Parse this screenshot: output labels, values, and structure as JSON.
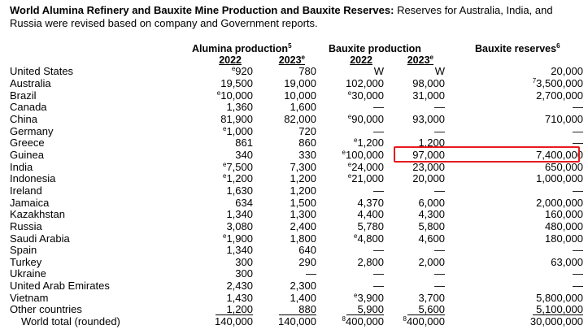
{
  "title": {
    "bold": "World Alumina Refinery and Bauxite Mine Production and Bauxite Reserves",
    "rest": " Reserves for Australia, India, and Russia were revised based on company and Government reports."
  },
  "headers": {
    "alumina": {
      "label": "Alumina production",
      "sup": "5"
    },
    "bauxite": {
      "label": "Bauxite production"
    },
    "reserves": {
      "label": "Bauxite reserves",
      "sup": "6"
    },
    "years": [
      {
        "v": "2022"
      },
      {
        "v": "2023",
        "sup": "e"
      },
      {
        "v": "2022"
      },
      {
        "v": "2023",
        "sup": "e"
      }
    ]
  },
  "highlight_color": "#e8191c",
  "rows": [
    {
      "country": "United States",
      "cells": [
        {
          "sup": "e",
          "v": "920"
        },
        {
          "v": "780"
        },
        {
          "v": "W"
        },
        {
          "v": "W"
        },
        {
          "v": "20,000"
        }
      ]
    },
    {
      "country": "Australia",
      "cells": [
        {
          "v": "19,500"
        },
        {
          "v": "19,000"
        },
        {
          "v": "102,000"
        },
        {
          "v": "98,000"
        },
        {
          "sup": "7",
          "v": "3,500,000"
        }
      ]
    },
    {
      "country": "Brazil",
      "cells": [
        {
          "sup": "e",
          "v": "10,000"
        },
        {
          "v": "10,000"
        },
        {
          "sup": "e",
          "v": "30,000"
        },
        {
          "v": "31,000"
        },
        {
          "v": "2,700,000"
        }
      ]
    },
    {
      "country": "Canada",
      "cells": [
        {
          "v": "1,360"
        },
        {
          "v": "1,600"
        },
        {
          "v": "—"
        },
        {
          "v": "—"
        },
        {
          "v": "—"
        }
      ]
    },
    {
      "country": "China",
      "cells": [
        {
          "v": "81,900"
        },
        {
          "v": "82,000"
        },
        {
          "sup": "e",
          "v": "90,000"
        },
        {
          "v": "93,000"
        },
        {
          "v": "710,000"
        }
      ]
    },
    {
      "country": "Germany",
      "cells": [
        {
          "sup": "e",
          "v": "1,000"
        },
        {
          "v": "720"
        },
        {
          "v": "—"
        },
        {
          "v": "—"
        },
        {
          "v": "—"
        }
      ]
    },
    {
      "country": "Greece",
      "cells": [
        {
          "v": "861"
        },
        {
          "v": "860"
        },
        {
          "sup": "e",
          "v": "1,200"
        },
        {
          "v": "1,200"
        },
        {
          "v": "—"
        }
      ]
    },
    {
      "country": "Guinea",
      "highlighted": true,
      "cells": [
        {
          "v": "340"
        },
        {
          "v": "330"
        },
        {
          "sup": "e",
          "v": "100,000"
        },
        {
          "v": "97,000"
        },
        {
          "v": "7,400,000"
        }
      ]
    },
    {
      "country": "India",
      "cells": [
        {
          "sup": "e",
          "v": "7,500"
        },
        {
          "v": "7,300"
        },
        {
          "sup": "e",
          "v": "24,000"
        },
        {
          "v": "23,000"
        },
        {
          "v": "650,000"
        }
      ]
    },
    {
      "country": "Indonesia",
      "cells": [
        {
          "sup": "e",
          "v": "1,200"
        },
        {
          "v": "1,200"
        },
        {
          "sup": "e",
          "v": "21,000"
        },
        {
          "v": "20,000"
        },
        {
          "v": "1,000,000"
        }
      ]
    },
    {
      "country": "Ireland",
      "cells": [
        {
          "v": "1,630"
        },
        {
          "v": "1,200"
        },
        {
          "v": "—"
        },
        {
          "v": "—"
        },
        {
          "v": "—"
        }
      ]
    },
    {
      "country": "Jamaica",
      "cells": [
        {
          "v": "634"
        },
        {
          "v": "1,500"
        },
        {
          "v": "4,370"
        },
        {
          "v": "6,000"
        },
        {
          "v": "2,000,000"
        }
      ]
    },
    {
      "country": "Kazakhstan",
      "cells": [
        {
          "v": "1,340"
        },
        {
          "v": "1,300"
        },
        {
          "v": "4,400"
        },
        {
          "v": "4,300"
        },
        {
          "v": "160,000"
        }
      ]
    },
    {
      "country": "Russia",
      "cells": [
        {
          "v": "3,080"
        },
        {
          "v": "2,400"
        },
        {
          "v": "5,780"
        },
        {
          "v": "5,800"
        },
        {
          "v": "480,000"
        }
      ]
    },
    {
      "country": "Saudi Arabia",
      "cells": [
        {
          "sup": "e",
          "v": "1,900"
        },
        {
          "v": "1,800"
        },
        {
          "sup": "e",
          "v": "4,800"
        },
        {
          "v": "4,600"
        },
        {
          "v": "180,000"
        }
      ]
    },
    {
      "country": "Spain",
      "cells": [
        {
          "v": "1,340"
        },
        {
          "v": "640"
        },
        {
          "v": "—"
        },
        {
          "v": "—"
        },
        {
          "v": "—"
        }
      ]
    },
    {
      "country": "Turkey",
      "cells": [
        {
          "v": "300"
        },
        {
          "v": "290"
        },
        {
          "v": "2,800"
        },
        {
          "v": "2,000"
        },
        {
          "v": "63,000"
        }
      ]
    },
    {
      "country": "Ukraine",
      "cells": [
        {
          "v": "300"
        },
        {
          "v": "—"
        },
        {
          "v": "—"
        },
        {
          "v": "—"
        },
        {
          "v": "—"
        }
      ]
    },
    {
      "country": "United Arab Emirates",
      "cells": [
        {
          "v": "2,430"
        },
        {
          "v": "2,300"
        },
        {
          "v": "—"
        },
        {
          "v": "—"
        },
        {
          "v": "—"
        }
      ]
    },
    {
      "country": "Vietnam",
      "cells": [
        {
          "v": "1,430"
        },
        {
          "v": "1,400"
        },
        {
          "sup": "e",
          "v": "3,900"
        },
        {
          "v": "3,700"
        },
        {
          "v": "5,800,000"
        }
      ]
    },
    {
      "country": "Other countries",
      "underline": true,
      "cells": [
        {
          "v": "1,200"
        },
        {
          "v": "880"
        },
        {
          "v": "5,900"
        },
        {
          "v": "5,600"
        },
        {
          "v": "5,100,000"
        }
      ]
    },
    {
      "country": "World total (rounded)",
      "total": true,
      "cells": [
        {
          "v": "140,000"
        },
        {
          "v": "140,000"
        },
        {
          "sup": "8",
          "v": "400,000"
        },
        {
          "sup": "8",
          "v": "400,000"
        },
        {
          "v": "30,000,000"
        }
      ]
    }
  ]
}
